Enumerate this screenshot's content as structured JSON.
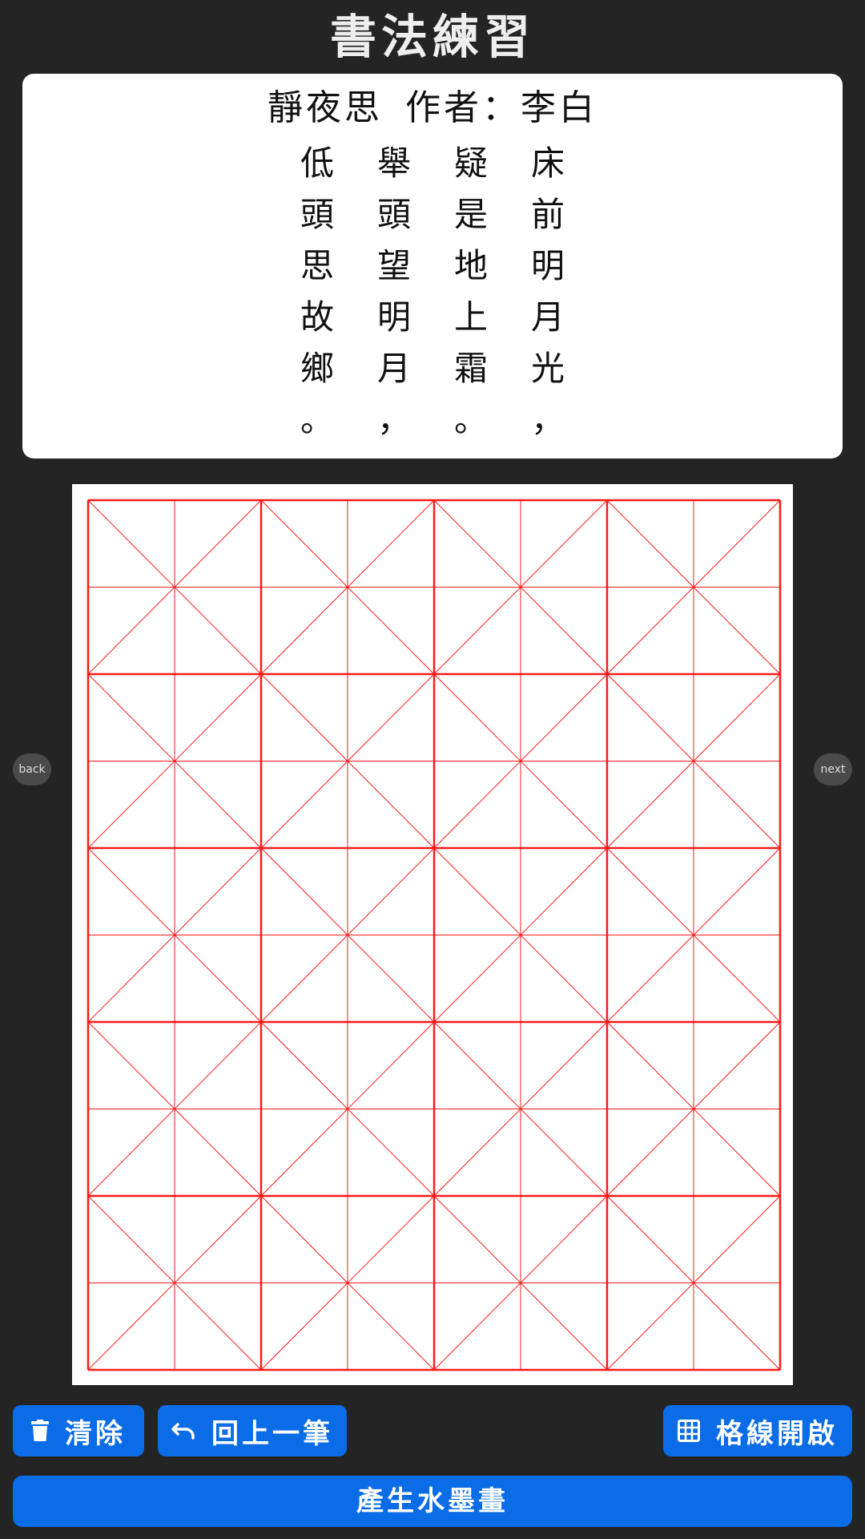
{
  "app": {
    "title": "書法練習"
  },
  "poem": {
    "title": "靜夜思",
    "author": "作者：李白",
    "columns": [
      [
        "床",
        "前",
        "明",
        "月",
        "光",
        "，"
      ],
      [
        "疑",
        "是",
        "地",
        "上",
        "霜",
        "。"
      ],
      [
        "舉",
        "頭",
        "望",
        "明",
        "月",
        "，"
      ],
      [
        "低",
        "頭",
        "思",
        "故",
        "鄉",
        "。"
      ]
    ]
  },
  "practice_grid": {
    "rows": 5,
    "cols": 4,
    "line_color": "#ff1a1a"
  },
  "nav": {
    "back_label": "back",
    "next_label": "next"
  },
  "toolbar": {
    "clear_label": "清除",
    "undo_label": "回上一筆",
    "grid_toggle_label": "格線開啟",
    "generate_label": "產生水墨畫"
  },
  "colors": {
    "background": "#242424",
    "accent": "#0a6ce6",
    "grid": "#ff1a1a"
  }
}
